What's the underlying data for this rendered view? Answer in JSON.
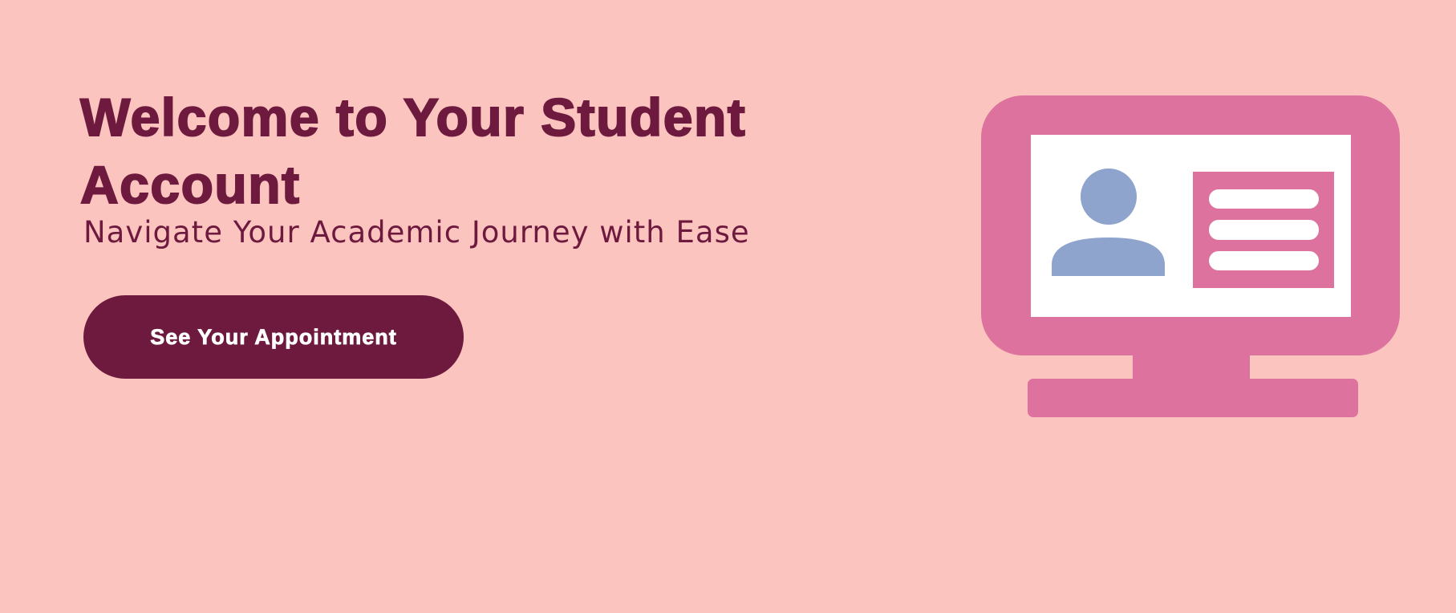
{
  "hero": {
    "title": "Welcome to Your Student Account",
    "subtitle": "Navigate Your Academic Journey with Ease",
    "cta_label": "See Your Appointment"
  },
  "illustration": {
    "icon": "monitor-student-profile-icon",
    "colors": {
      "background": "#fcc4bf",
      "monitor": "#de729f",
      "avatar": "#8ea4cc",
      "text": "#6e1a3f"
    }
  }
}
